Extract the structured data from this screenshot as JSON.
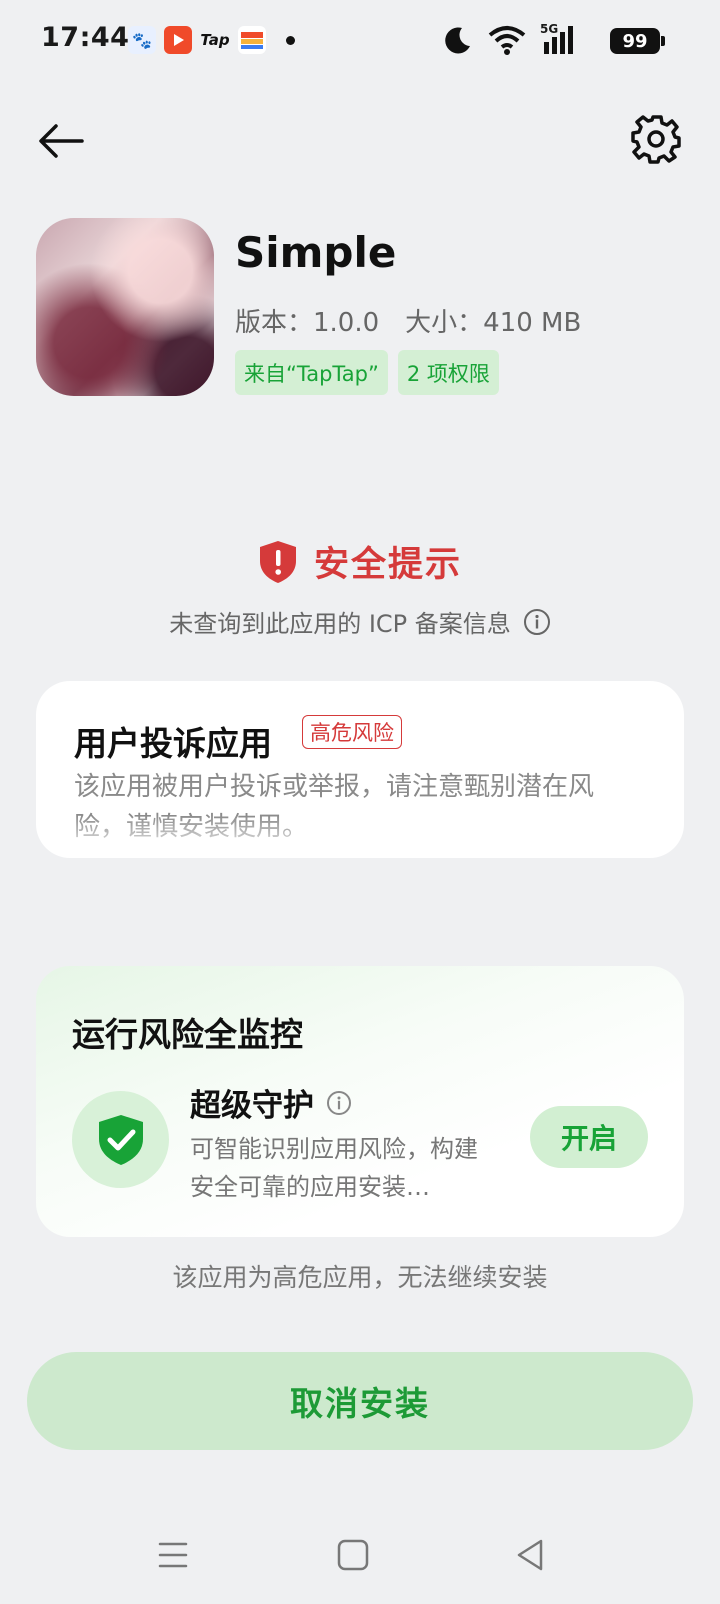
{
  "status_bar": {
    "time": "17:44",
    "battery": "99",
    "network": "5G",
    "notification_icons": [
      "baidu-icon",
      "video-icon",
      "taptap-icon",
      "flag-icon"
    ],
    "tap_label": "Tap"
  },
  "header": {
    "back_icon": "arrow-left-icon",
    "settings_icon": "gear-icon"
  },
  "app": {
    "name": "Simple",
    "version": "版本：1.0.0",
    "size": "大小：410 MB",
    "tags": [
      "来自“TapTap”",
      "2 项权限"
    ]
  },
  "security": {
    "title": "安全提示",
    "subtitle": "未查询到此应用的 ICP 备案信息",
    "accent_color": "#d53a3a"
  },
  "complaint_card": {
    "title": "用户投诉应用",
    "badge": "高危风险",
    "description": "该应用被用户投诉或举报，请注意甄别潜在风险，谨慎安装使用。"
  },
  "monitor_card": {
    "title": "运行风险全监控",
    "guard_title": "超级守护",
    "guard_desc": "可智能识别应用风险，构建安全可靠的应用安装…",
    "open_label": "开启"
  },
  "notice": "该应用为高危应用，无法继续安装",
  "cancel_label": "取消安装",
  "colors": {
    "green": "#18a337",
    "green_bg": "#cde9cd",
    "page_bg": "#eff0f2"
  },
  "nav": [
    "menu-icon",
    "home-icon",
    "back-triangle-icon"
  ]
}
